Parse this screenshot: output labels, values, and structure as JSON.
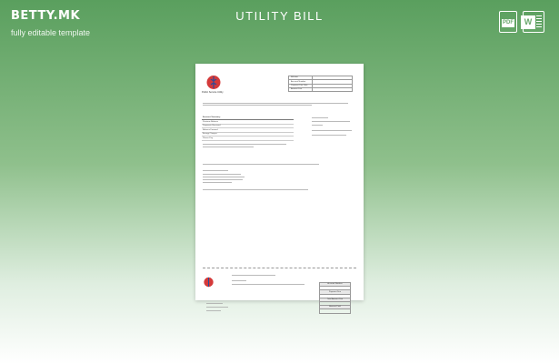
{
  "brand": {
    "logo": "BETTY.MK",
    "tagline": "fully editable template"
  },
  "title": "UTILITY BILL",
  "file_icons": [
    {
      "name": "pdf-icon",
      "label": "PDF"
    },
    {
      "name": "word-icon",
      "label": "W"
    }
  ],
  "colors": {
    "background_top": "#5a9f5e",
    "background_bottom": "#ffffff",
    "logo_red": "#d43a3a",
    "logo_blue": "#2a4c9a"
  },
  "document": {
    "company_name": "Public Service Utility",
    "account_rows": [
      {
        "label": "Bill date",
        "value": ""
      },
      {
        "label": "Account Number",
        "value": ""
      },
      {
        "label": "Payment Due Date",
        "value": ""
      },
      {
        "label": "Amount Due",
        "value": ""
      }
    ],
    "summary": {
      "title": "Account Summary",
      "rows": [
        {
          "label": "Previous Balance",
          "value": ""
        },
        {
          "label": "Payments Received",
          "value": ""
        },
        {
          "label": "Balance Forward",
          "value": ""
        },
        {
          "label": "Energy Charges",
          "value": ""
        },
        {
          "label": "Please Pay",
          "value": ""
        }
      ]
    },
    "stub_rows": [
      "Account Number",
      "",
      "Payment Due",
      "",
      "Total Amount Due",
      "",
      "Amount Paid",
      ""
    ]
  }
}
